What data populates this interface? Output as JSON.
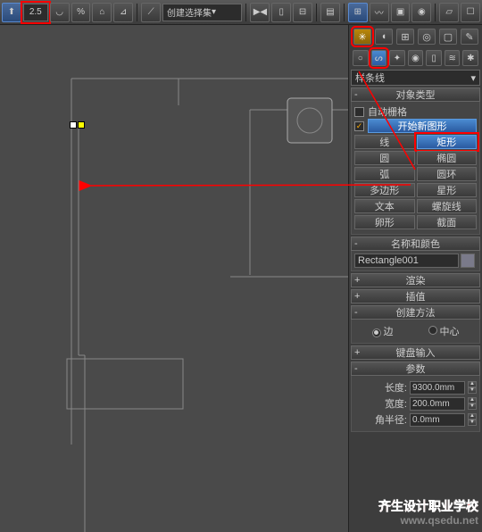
{
  "toolbar": {
    "snap_value": "2.5",
    "selection_set": "创建选择集"
  },
  "panel": {
    "category_dropdown": "样条线",
    "object_type": {
      "header": "对象类型",
      "auto_grid": "自动栅格",
      "start_new_shape": "开始新图形",
      "buttons": [
        [
          "线",
          "矩形"
        ],
        [
          "圆",
          "椭圆"
        ],
        [
          "弧",
          "圆环"
        ],
        [
          "多边形",
          "星形"
        ],
        [
          "文本",
          "螺旋线"
        ],
        [
          "卵形",
          "截面"
        ]
      ]
    },
    "name_color": {
      "header": "名称和颜色",
      "name": "Rectangle001"
    },
    "rollouts": {
      "render": "渲染",
      "interp": "插值",
      "creation": "创建方法",
      "edge": "边",
      "center": "中心",
      "keyboard": "键盘输入",
      "params": "参数"
    },
    "params": {
      "length_label": "长度:",
      "length": "9300.0mm",
      "width_label": "宽度:",
      "width": "200.0mm",
      "corner_label": "角半径:",
      "corner": "0.0mm"
    }
  },
  "watermark": {
    "line1": "齐生设计职业学校",
    "line2": "www.qsedu.net"
  }
}
